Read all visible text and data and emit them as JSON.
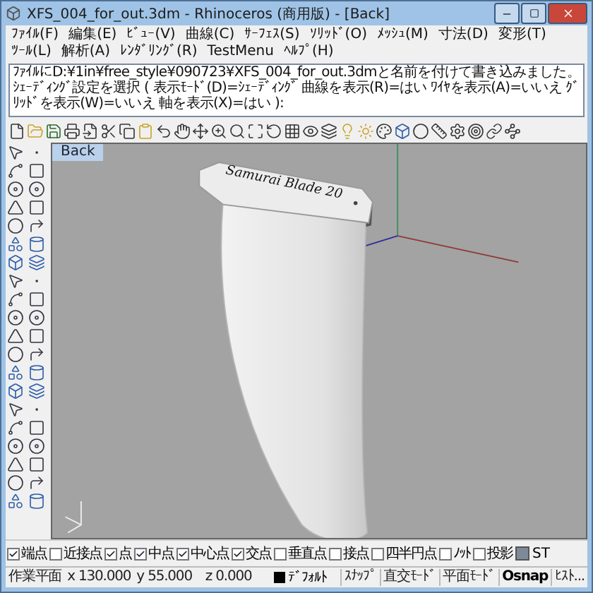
{
  "window": {
    "title": "XFS_004_for_out.3dm - Rhinoceros (商用版) - [Back]"
  },
  "menu": [
    {
      "label": "ﾌｧｲﾙ(F)"
    },
    {
      "label": "編集(E)"
    },
    {
      "label": "ﾋﾞｭｰ(V)"
    },
    {
      "label": "曲線(C)"
    },
    {
      "label": "ｻｰﾌｪｽ(S)"
    },
    {
      "label": "ｿﾘｯﾄﾞ(O)"
    },
    {
      "label": "ﾒｯｼｭ(M)"
    },
    {
      "label": "寸法(D)"
    },
    {
      "label": "変形(T)"
    },
    {
      "label": "ﾂｰﾙ(L)"
    },
    {
      "label": "解析(A)"
    },
    {
      "label": "ﾚﾝﾀﾞﾘﾝｸﾞ(R)"
    },
    {
      "label": "TestMenu"
    },
    {
      "label": "ﾍﾙﾌﾟ(H)"
    }
  ],
  "command_history": [
    "ﾌｧｲﾙにD:¥1in¥free_style¥090723¥XFS_004_for_out.3dmと名前を付けて書き込みました。",
    "ｼｪｰﾃﾞｨﾝｸﾞ設定を選択 ( 表示ﾓｰﾄﾞ(D)=ｼｪｰﾃﾞｨﾝｸﾞ 曲線を表示(R)=はい ﾜｲﾔを表示(A)=いいえ ｸﾞﾘｯﾄﾞを表示(W)=いいえ 軸を表示(X)=はい ):"
  ],
  "viewport": {
    "title": "Back",
    "model_label": "Samurai Blade 20"
  },
  "osnap": [
    {
      "label": "端点",
      "checked": true
    },
    {
      "label": "近接点",
      "checked": false
    },
    {
      "label": "点",
      "checked": true
    },
    {
      "label": "中点",
      "checked": true
    },
    {
      "label": "中心点",
      "checked": true
    },
    {
      "label": "交点",
      "checked": true
    },
    {
      "label": "垂直点",
      "checked": false
    },
    {
      "label": "接点",
      "checked": false
    },
    {
      "label": "四半円点",
      "checked": false
    },
    {
      "label": "ﾉｯﾄ",
      "checked": false
    },
    {
      "label": "投影",
      "checked": false
    }
  ],
  "osnap_button": "ST",
  "status_bar": [
    {
      "kind": "text",
      "label": "作業平面"
    },
    {
      "kind": "text",
      "label": "x 130.000"
    },
    {
      "kind": "text",
      "label": "y 55.000"
    },
    {
      "kind": "text",
      "label": "z 0.000"
    },
    {
      "kind": "layer",
      "label": "ﾃﾞﾌｫﾙﾄ"
    },
    {
      "kind": "toggle",
      "label": "ｽﾅｯﾌﾟ",
      "on": false
    },
    {
      "kind": "toggle",
      "label": "直交ﾓｰﾄﾞ",
      "on": false
    },
    {
      "kind": "toggle",
      "label": "平面ﾓｰﾄﾞ",
      "on": false
    },
    {
      "kind": "toggle",
      "label": "Osnap",
      "on": true
    },
    {
      "kind": "toggle",
      "label": "ﾋｽﾄ...",
      "on": false
    }
  ]
}
